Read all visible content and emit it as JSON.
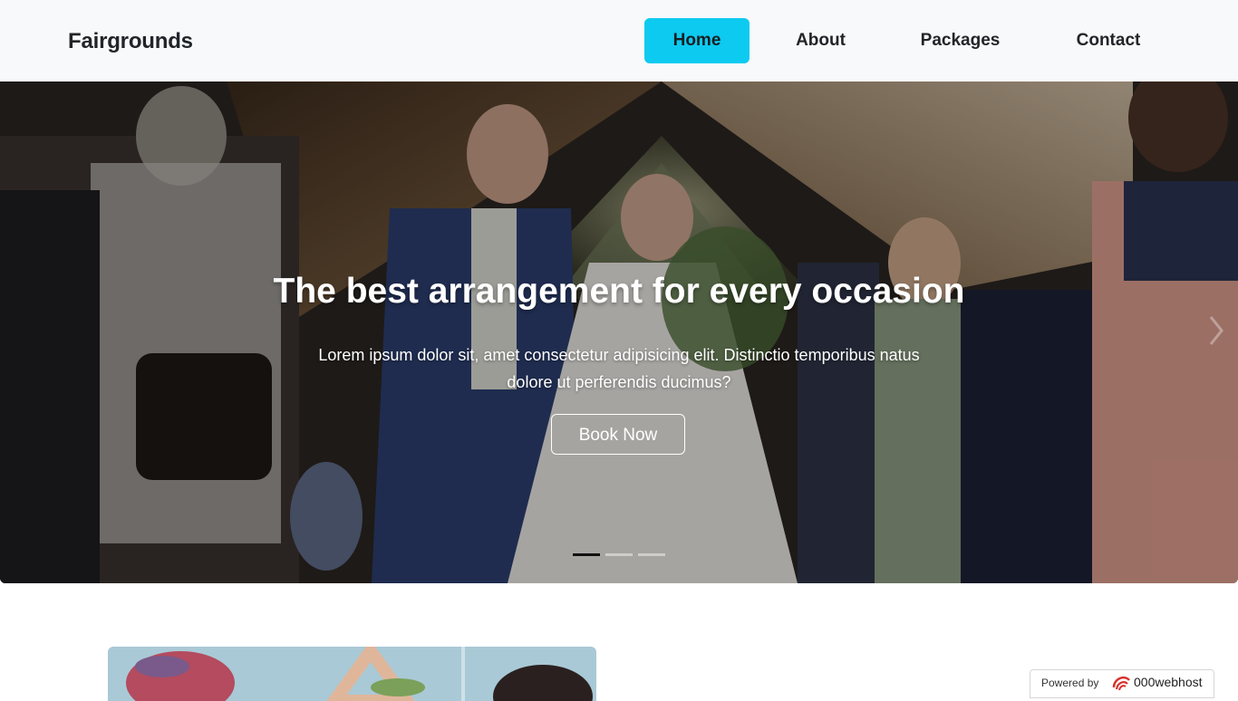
{
  "navbar": {
    "brand": "Fairgrounds",
    "links": [
      {
        "label": "Home",
        "active": true
      },
      {
        "label": "About",
        "active": false
      },
      {
        "label": "Packages",
        "active": false
      },
      {
        "label": "Contact",
        "active": false
      }
    ],
    "active_color": "#0dcaf0",
    "background": "#f8f9fa"
  },
  "hero": {
    "title": "The best arrangement for every occasion",
    "text": "Lorem ipsum dolor sit, amet consectetur adipisicing elit. Distinctio temporibus natus dolore ut perferendis ducimus?",
    "button_label": "Book Now",
    "slide_count": 3,
    "active_slide": 1,
    "next_icon": "chevron-right-icon"
  },
  "footer_badge": {
    "label": "Powered by",
    "brand": "000webhost",
    "logo_icon": "000webhost-logo-icon"
  }
}
